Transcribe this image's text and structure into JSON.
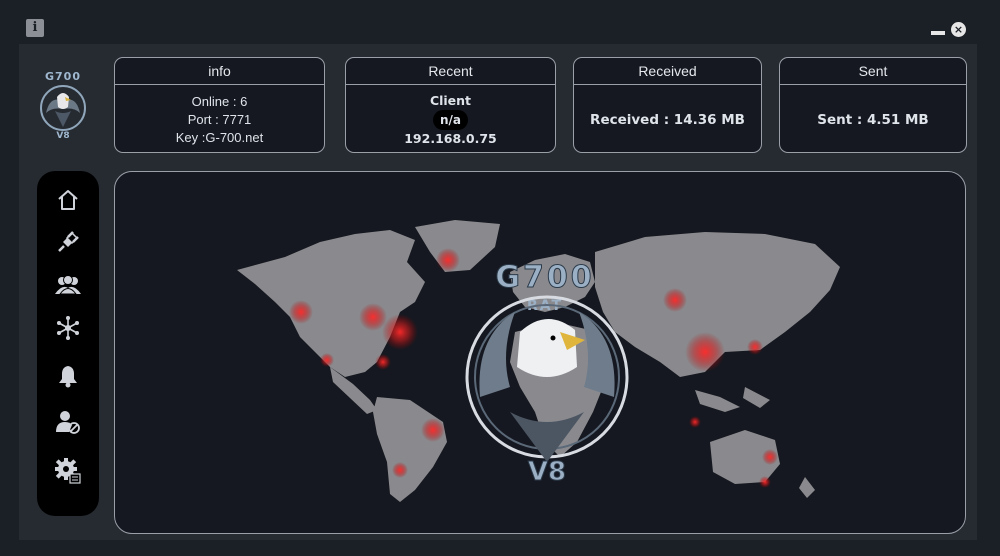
{
  "window": {
    "info_icon": "i",
    "minimize_icon": "minimize-icon",
    "close_icon": "×"
  },
  "logo": {
    "brand": "G700",
    "version": "V8"
  },
  "cards": {
    "info": {
      "title": "info",
      "online": "Online : 6",
      "port": "Port : 7771",
      "key": "Key :G-700.net"
    },
    "recent": {
      "title": "Recent",
      "client_label": "Client",
      "client_value": "n/a",
      "ip": "192.168.0.75"
    },
    "received": {
      "title": "Received",
      "value": "Received : 14.36 MB"
    },
    "sent": {
      "title": "Sent",
      "value": "Sent : 4.51 MB"
    }
  },
  "sidebar": {
    "items": [
      {
        "icon": "home-icon"
      },
      {
        "icon": "plug-icon"
      },
      {
        "icon": "users-icon"
      },
      {
        "icon": "network-icon"
      },
      {
        "icon": "bell-icon"
      },
      {
        "icon": "user-blocked-icon"
      },
      {
        "icon": "settings-icon"
      }
    ]
  },
  "map": {
    "emblem_brand": "G700",
    "emblem_sub": "RAT",
    "emblem_version": "V8",
    "hotspot_color": "#e0282a",
    "land_color": "#8a8a8e"
  }
}
